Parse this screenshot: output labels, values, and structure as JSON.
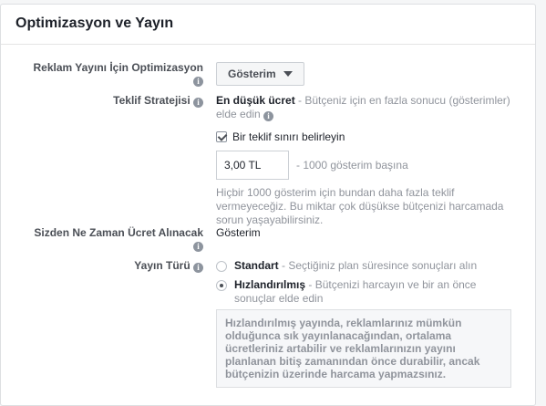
{
  "header": {
    "title": "Optimizasyon ve Yayın"
  },
  "optimization": {
    "label": "Reklam Yayını İçin Optimizasyon",
    "value": "Gösterim",
    "icon": "info-icon"
  },
  "bid_strategy": {
    "label": "Teklif Stratejisi",
    "value_bold": "En düşük ücret",
    "value_desc": " - Bütçeniz için en fazla sonucu (gösterimler) elde edin",
    "checkbox_label": "Bir teklif sınırı belirleyin",
    "checkbox_checked": true,
    "bid_value": "3,00 TL",
    "bid_suffix": "- 1000 gösterim başına",
    "help_text": "Hiçbir 1000 gösterim için bundan daha fazla teklif vermeyeceğiz. Bu miktar çok düşükse bütçenizi harcamada sorun yaşayabilirsiniz."
  },
  "charge": {
    "label": "Sizden Ne Zaman Ücret Alınacak",
    "value": "Gösterim"
  },
  "delivery_type": {
    "label": "Yayın Türü",
    "options": [
      {
        "title": "Standart",
        "desc": " - Seçtiğiniz plan süresince sonuçları alın",
        "checked": false
      },
      {
        "title": "Hızlandırılmış",
        "desc": " - Bütçenizi harcayın ve bir an önce sonuçlar elde edin",
        "checked": true
      }
    ],
    "note": "Hızlandırılmış yayında, reklamlarınız mümkün olduğunca sık yayınlanacağından, ortalama ücretleriniz artabilir ve reklamlarınızın yayını planlanan bitiş zamanından önce durabilir, ancak bütçenizin üzerinde harcama yapmazsınız."
  },
  "colors": {
    "label_text": "#4b4f56",
    "grey_text": "#90949c",
    "border": "#dddfe2"
  }
}
